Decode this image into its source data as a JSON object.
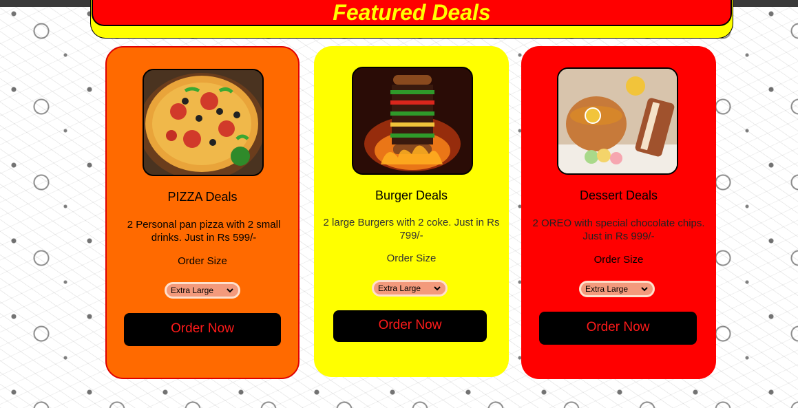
{
  "header": {
    "title": "Featured Deals"
  },
  "colors": {
    "header_outer": "#ffff00",
    "header_inner": "#ff0000",
    "card_pizza": "#ff6a00",
    "card_burger": "#ffff00",
    "card_dessert": "#ff0000",
    "button_bg": "#000000",
    "button_text": "#ff1a1a"
  },
  "cards": [
    {
      "title": "PIZZA Deals",
      "description": "2 Personal pan pizza with 2 small drinks. Just in Rs 599/-",
      "size_label": "Order Size",
      "selected_size": "Extra Large",
      "button": "Order Now",
      "image": "pizza-image"
    },
    {
      "title": "Burger Deals",
      "description": "2 large Burgers with 2 coke. Just in Rs 799/-",
      "size_label": "Order Size",
      "selected_size": "Extra Large",
      "button": "Order Now",
      "image": "burger-image"
    },
    {
      "title": "Dessert Deals",
      "description": "2 OREO with special chocolate chips. Just in Rs 999/-",
      "size_label": "Order Size",
      "selected_size": "Extra Large",
      "button": "Order Now",
      "image": "dessert-image"
    }
  ]
}
